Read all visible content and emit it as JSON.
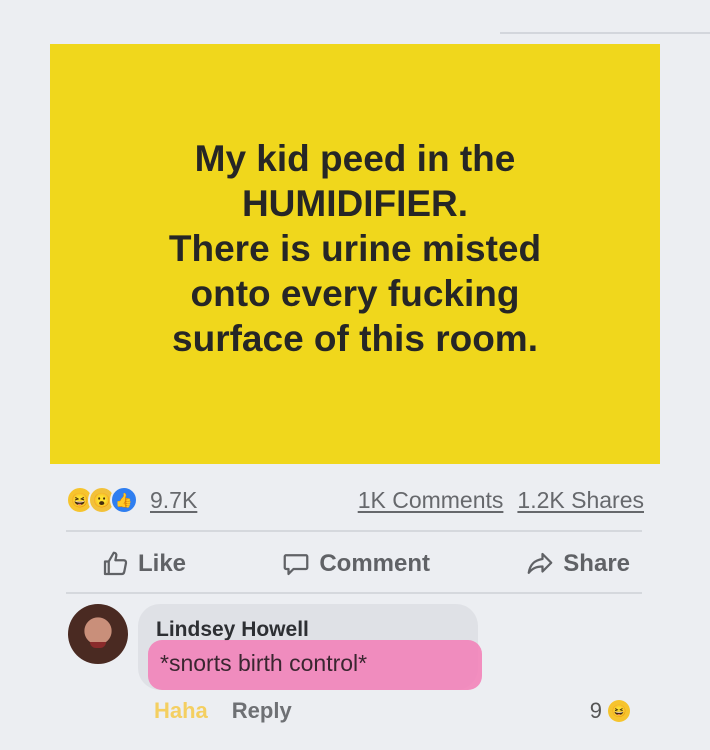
{
  "post": {
    "lines": [
      "My kid peed in the",
      "HUMIDIFIER.",
      "There is urine misted",
      "onto every fucking",
      "surface of this room."
    ],
    "background_color": "#f0d71c"
  },
  "stats": {
    "reaction_icons": [
      "haha-icon",
      "wow-icon",
      "like-icon"
    ],
    "reactions_count": "9.7K",
    "comments_count": "1K Comments",
    "shares_count": "1.2K Shares"
  },
  "actions": {
    "like_label": "Like",
    "comment_label": "Comment",
    "share_label": "Share"
  },
  "comment": {
    "author": "Lindsey Howell",
    "text": "*snorts birth control*",
    "haha_label": "Haha",
    "reply_label": "Reply",
    "reaction_count": "9",
    "highlight_color": "#f37db6"
  }
}
